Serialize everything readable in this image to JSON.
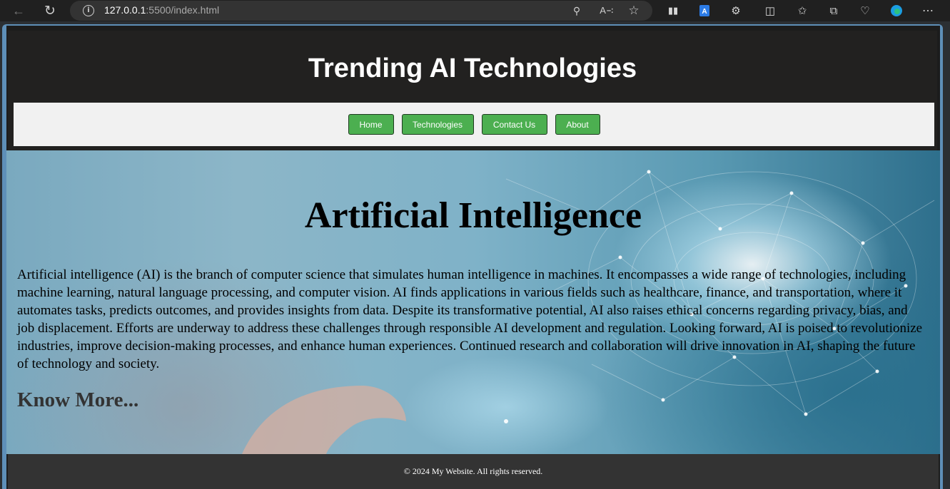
{
  "browser": {
    "url_host": "127.0.0.1",
    "url_rest": ":5500/index.html",
    "icons": [
      "back-icon",
      "reload-icon",
      "info-icon",
      "zoom-icon",
      "read-aloud-icon",
      "favorite-star-icon",
      "extension-icon",
      "extensions-puzzle-icon",
      "split-screen-icon",
      "favorites-icon",
      "collections-icon",
      "health-icon",
      "edge-icon",
      "more-icon"
    ]
  },
  "header": {
    "title": "Trending AI Technologies"
  },
  "nav": {
    "home": "Home",
    "technologies": "Technologies",
    "contact": "Contact Us",
    "about": "About"
  },
  "hero": {
    "title": "Artificial Intelligence",
    "body": "Artificial intelligence (AI) is the branch of computer science that simulates human intelligence in machines. It encompasses a wide range of technologies, including machine learning, natural language processing, and computer vision. AI finds applications in various fields such as healthcare, finance, and transportation, where it automates tasks, predicts outcomes, and provides insights from data. Despite its transformative potential, AI also raises ethical concerns regarding privacy, bias, and job displacement. Efforts are underway to address these challenges through responsible AI development and regulation. Looking forward, AI is poised to revolutionize industries, improve decision-making processes, and enhance human experiences. Continued research and collaboration will drive innovation in AI, shaping the future of technology and society.",
    "link": "Know More..."
  },
  "footer": {
    "text": "© 2024 My Website. All rights reserved."
  },
  "colors": {
    "nav_button": "#4caf50",
    "header_bg": "#222120",
    "footer_bg": "#333333",
    "nav_bar_bg": "#f1f1f1"
  }
}
